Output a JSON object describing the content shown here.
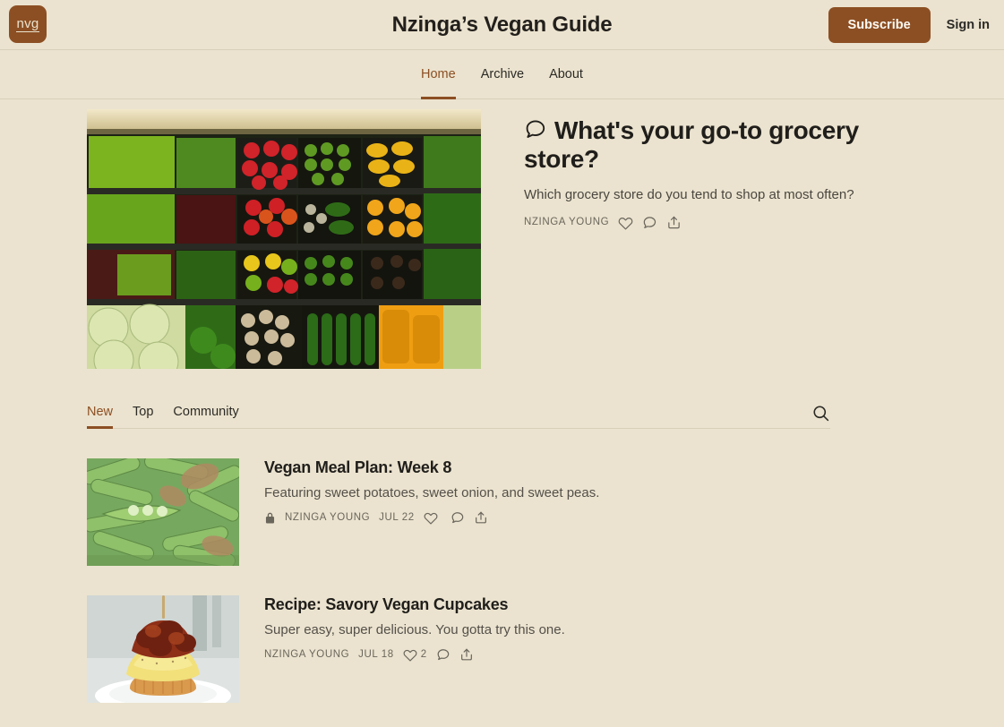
{
  "theme": {
    "background": "#EBE3CF",
    "accent": "#8C4F23",
    "text": "#2b2a26",
    "muted": "#6a665c",
    "divider": "#d9d0ba"
  },
  "masthead": {
    "logo_text": "nvg",
    "logo_icon": "nvg-wordmark-logo",
    "site_title": "Nzinga’s Vegan Guide",
    "subscribe_label": "Subscribe",
    "signin_label": "Sign in"
  },
  "nav": {
    "items": [
      {
        "label": "Home",
        "active": true
      },
      {
        "label": "Archive",
        "active": false
      },
      {
        "label": "About",
        "active": false
      }
    ]
  },
  "hero": {
    "image_alt": "grocery-produce-shelves",
    "icon": "comment-bubble-icon",
    "title": "What's your go-to grocery store?",
    "subtitle": "Which grocery store do you tend to shop at most often?",
    "author": "NZINGA YOUNG",
    "actions": [
      {
        "icon": "heart-icon",
        "count": ""
      },
      {
        "icon": "comment-icon",
        "count": ""
      },
      {
        "icon": "share-icon",
        "count": ""
      }
    ]
  },
  "feed": {
    "tabs": [
      {
        "label": "New",
        "active": true
      },
      {
        "label": "Top",
        "active": false
      },
      {
        "label": "Community",
        "active": false
      }
    ],
    "search_icon": "search-icon",
    "posts": [
      {
        "thumb_alt": "green-pea-pods",
        "title": "Vegan Meal Plan: Week 8",
        "subtitle": "Featuring sweet potatoes, sweet onion, and sweet peas.",
        "locked": true,
        "lock_icon": "lock-icon",
        "author": "NZINGA YOUNG",
        "date": "JUL 22",
        "actions": [
          {
            "icon": "heart-icon",
            "count": ""
          },
          {
            "icon": "comment-icon",
            "count": ""
          },
          {
            "icon": "share-icon",
            "count": ""
          }
        ]
      },
      {
        "thumb_alt": "savory-vegan-cupcake",
        "title": "Recipe: Savory Vegan Cupcakes",
        "subtitle": "Super easy, super delicious. You gotta try this one.",
        "locked": false,
        "lock_icon": "",
        "author": "NZINGA YOUNG",
        "date": "JUL 18",
        "actions": [
          {
            "icon": "heart-icon",
            "count": "2"
          },
          {
            "icon": "comment-icon",
            "count": ""
          },
          {
            "icon": "share-icon",
            "count": ""
          }
        ]
      }
    ]
  }
}
